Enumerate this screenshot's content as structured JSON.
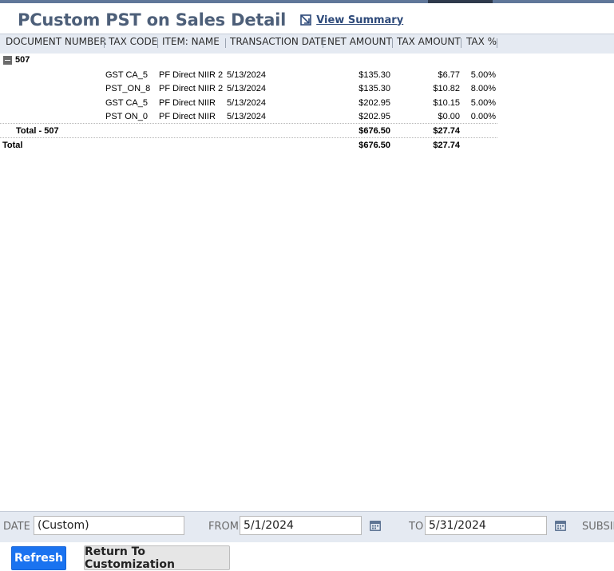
{
  "header": {
    "title": "PCustom PST on Sales Detail",
    "view_summary": "View Summary"
  },
  "columns": [
    "DOCUMENT NUMBER",
    "TAX CODE",
    "ITEM: NAME",
    "TRANSACTION DATE",
    "NET AMOUNT",
    "TAX AMOUNT",
    "TAX %"
  ],
  "group": {
    "label": "507"
  },
  "rows": [
    {
      "tax_code": "GST CA_5",
      "item": "PF Direct NIIR 2",
      "date": "5/13/2024",
      "net": "$135.30",
      "tax": "$6.77",
      "pct": "5.00%"
    },
    {
      "tax_code": "PST_ON_8",
      "item": "PF Direct NIIR 2",
      "date": "5/13/2024",
      "net": "$135.30",
      "tax": "$10.82",
      "pct": "8.00%"
    },
    {
      "tax_code": "GST CA_5",
      "item": "PF Direct NIIR",
      "date": "5/13/2024",
      "net": "$202.95",
      "tax": "$10.15",
      "pct": "5.00%"
    },
    {
      "tax_code": "PST ON_0",
      "item": "PF Direct NIIR",
      "date": "5/13/2024",
      "net": "$202.95",
      "tax": "$0.00",
      "pct": "0.00%"
    }
  ],
  "group_total": {
    "label": "Total - 507",
    "net": "$676.50",
    "tax": "$27.74"
  },
  "grand_total": {
    "label": "Total",
    "net": "$676.50",
    "tax": "$27.74"
  },
  "filters": {
    "date_label": "DATE",
    "date_value": "(Custom)",
    "from_label": "FROM",
    "from_value": "5/1/2024",
    "to_label": "TO",
    "to_value": "5/31/2024",
    "subsidiary_label": "SUBSID"
  },
  "buttons": {
    "refresh": "Refresh",
    "return": "Return To Customization"
  },
  "colors": {
    "title": "#4d5f79",
    "header_bg": "#e5eaf2",
    "primary_button": "#1a73f0"
  }
}
